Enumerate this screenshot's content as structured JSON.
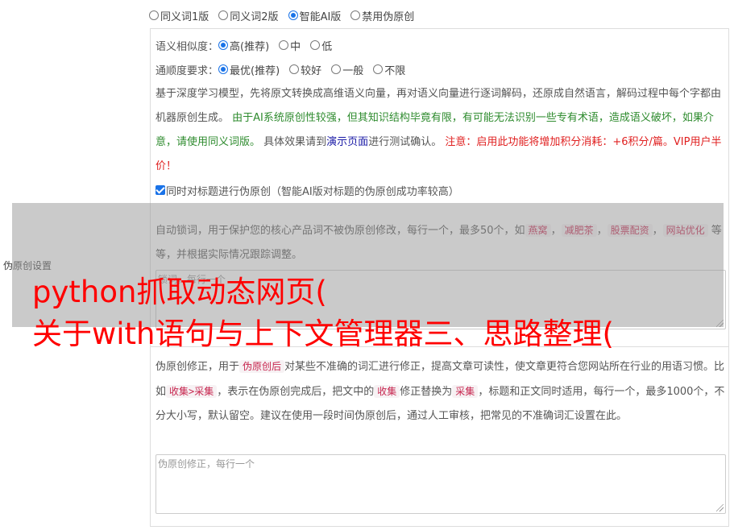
{
  "mode_options": [
    {
      "label": "同义词1版",
      "selected": false
    },
    {
      "label": "同义词2版",
      "selected": false
    },
    {
      "label": "智能AI版",
      "selected": true
    },
    {
      "label": "禁用伪原创",
      "selected": false
    }
  ],
  "similarity": {
    "label": "语义相似度：",
    "options": [
      {
        "label": "高(推荐)",
        "selected": true
      },
      {
        "label": "中",
        "selected": false
      },
      {
        "label": "低",
        "selected": false
      }
    ]
  },
  "fluency": {
    "label": "通顺度要求：",
    "options": [
      {
        "label": "最优(推荐)",
        "selected": true
      },
      {
        "label": "较好",
        "selected": false
      },
      {
        "label": "一般",
        "selected": false
      },
      {
        "label": "不限",
        "selected": false
      }
    ]
  },
  "description": {
    "part1": "基于深度学习模型，先将原文转换成高维语义向量，再对语义向量进行逐词解码，还原成自然语言，解码过程中每个字都由机器原创生成。",
    "warning_green": "由于AI系统原创性较强，但其知识结构毕竟有限，有可能无法识别一些专有术语，造成语义破坏，如果介意，请使用同义词版。",
    "part2": "具体效果请到",
    "demo_link": "演示页面",
    "part3": "进行测试确认。",
    "cost_red": "注意：启用此功能将增加积分消耗：+6积分/篇。VIP用户半价！"
  },
  "title_checkbox": {
    "label": "同时对标题进行伪原创（智能AI版对标题的伪原创成功率较高）",
    "checked": true
  },
  "section_label": "伪原创设置",
  "lock_words": {
    "desc_before": "自动锁词，用于保护您的核心产品词不被伪原创修改，每行一个，最多50个，如",
    "examples": [
      "燕窝",
      "减肥茶",
      "股票配资",
      "网站优化"
    ],
    "sep": "，",
    "desc_after": "等等，并根据实际情况跟踪调整。",
    "placeholder": "锁词，每行一个"
  },
  "correction": {
    "t1": "伪原创修正，用于",
    "tag1": "伪原创后",
    "t2": "对某些不准确的词汇进行修正，提高文章可读性，使文章更符合您网站所在行业的用语习惯。比如",
    "tag2": "收集>采集",
    "t3": "，表示在伪原创完成后，把文中的",
    "tag3": "收集",
    "t4": "修正替换为",
    "tag4": "采集",
    "t5": "，标题和正文同时适用，每行一个，最多1000个，不分大小写，默认留空。建议在使用一段时间伪原创后，通过人工审核，把常见的不准确词汇设置在此。",
    "placeholder": "伪原创修正，每行一个"
  },
  "overlay": {
    "line1": "python抓取动态网页(",
    "line2": "关于with语句与上下文管理器三、思路整理("
  },
  "colors": {
    "accent": "#1a73e8",
    "green": "#2e8b2e",
    "red": "#e02020",
    "overlay_text": "#ff0000"
  }
}
